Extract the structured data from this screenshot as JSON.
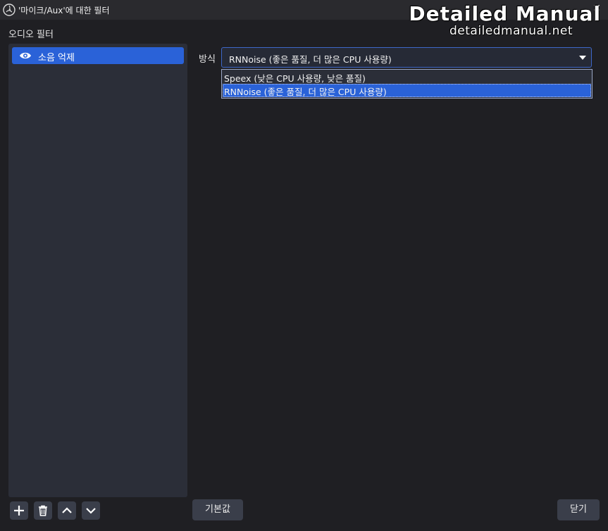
{
  "window": {
    "title": "'마이크/Aux'에 대한 필터",
    "close_icon": "close-icon",
    "app_icon": "obs-logo-icon"
  },
  "watermark": {
    "title": "Detailed Manual",
    "url": "detailedmanual.net"
  },
  "filters_panel": {
    "section_label": "오디오 필터",
    "items": [
      {
        "label": "소음 억제",
        "icon": "eye-icon",
        "selected": true
      }
    ],
    "tools": [
      "plus-icon",
      "trash-icon",
      "chevron-up-icon",
      "chevron-down-icon"
    ]
  },
  "properties": {
    "method_label": "방식",
    "method_value": "RNNoise (좋은 품질, 더 많은 CPU 사용량)",
    "options": [
      "Speex (낮은 CPU 사용량, 낮은 품질)",
      "RNNoise (좋은 품질, 더 많은 CPU 사용량)"
    ],
    "highlighted_option": 1
  },
  "buttons": {
    "defaults": "기본값",
    "close": "닫기"
  },
  "colors": {
    "accent": "#2a62d8",
    "background": "#1f1f23",
    "panel": "#2b2e38"
  }
}
